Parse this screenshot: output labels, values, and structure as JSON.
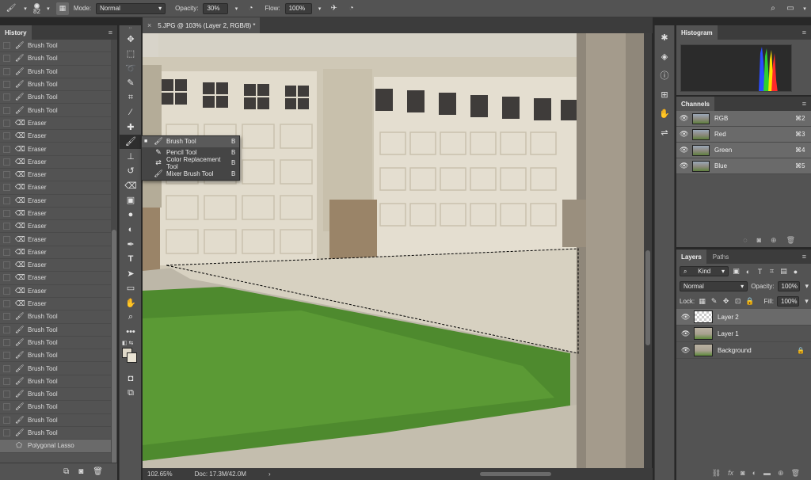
{
  "options_bar": {
    "brush_size": "82",
    "mode_label": "Mode:",
    "mode_value": "Normal",
    "opacity_label": "Opacity:",
    "opacity_value": "30%",
    "flow_label": "Flow:",
    "flow_value": "100%"
  },
  "history": {
    "title": "History",
    "items": [
      {
        "label": "Brush Tool",
        "icon": "brush-icon"
      },
      {
        "label": "Brush Tool",
        "icon": "brush-icon"
      },
      {
        "label": "Brush Tool",
        "icon": "brush-icon"
      },
      {
        "label": "Brush Tool",
        "icon": "brush-icon"
      },
      {
        "label": "Brush Tool",
        "icon": "brush-icon"
      },
      {
        "label": "Brush Tool",
        "icon": "brush-icon"
      },
      {
        "label": "Eraser",
        "icon": "eraser-icon"
      },
      {
        "label": "Eraser",
        "icon": "eraser-icon"
      },
      {
        "label": "Eraser",
        "icon": "eraser-icon"
      },
      {
        "label": "Eraser",
        "icon": "eraser-icon"
      },
      {
        "label": "Eraser",
        "icon": "eraser-icon"
      },
      {
        "label": "Eraser",
        "icon": "eraser-icon"
      },
      {
        "label": "Eraser",
        "icon": "eraser-icon"
      },
      {
        "label": "Eraser",
        "icon": "eraser-icon"
      },
      {
        "label": "Eraser",
        "icon": "eraser-icon"
      },
      {
        "label": "Eraser",
        "icon": "eraser-icon"
      },
      {
        "label": "Eraser",
        "icon": "eraser-icon"
      },
      {
        "label": "Eraser",
        "icon": "eraser-icon"
      },
      {
        "label": "Eraser",
        "icon": "eraser-icon"
      },
      {
        "label": "Eraser",
        "icon": "eraser-icon"
      },
      {
        "label": "Eraser",
        "icon": "eraser-icon"
      },
      {
        "label": "Brush Tool",
        "icon": "brush-icon"
      },
      {
        "label": "Brush Tool",
        "icon": "brush-icon"
      },
      {
        "label": "Brush Tool",
        "icon": "brush-icon"
      },
      {
        "label": "Brush Tool",
        "icon": "brush-icon"
      },
      {
        "label": "Brush Tool",
        "icon": "brush-icon"
      },
      {
        "label": "Brush Tool",
        "icon": "brush-icon"
      },
      {
        "label": "Brush Tool",
        "icon": "brush-icon"
      },
      {
        "label": "Brush Tool",
        "icon": "brush-icon"
      },
      {
        "label": "Brush Tool",
        "icon": "brush-icon"
      },
      {
        "label": "Brush Tool",
        "icon": "brush-icon"
      },
      {
        "label": "Polygonal Lasso",
        "icon": "polygonal-lasso-icon",
        "selected": true
      }
    ]
  },
  "document": {
    "tab_title": "5.JPG @ 103% (Layer 2, RGB/8) *",
    "zoom": "102.65%",
    "doc_size": "Doc: 17.3M/42.0M"
  },
  "tool_flyout": {
    "items": [
      {
        "label": "Brush Tool",
        "key": "B",
        "active": true
      },
      {
        "label": "Pencil Tool",
        "key": "B"
      },
      {
        "label": "Color Replacement Tool",
        "key": "B"
      },
      {
        "label": "Mixer Brush Tool",
        "key": "B"
      }
    ]
  },
  "histogram": {
    "title": "Histogram"
  },
  "channels": {
    "title": "Channels",
    "items": [
      {
        "name": "RGB",
        "shortcut": "⌘2"
      },
      {
        "name": "Red",
        "shortcut": "⌘3"
      },
      {
        "name": "Green",
        "shortcut": "⌘4"
      },
      {
        "name": "Blue",
        "shortcut": "⌘5"
      }
    ]
  },
  "layers": {
    "tab_layers": "Layers",
    "tab_paths": "Paths",
    "filter_kind": "Kind",
    "blend_mode": "Normal",
    "opacity_label": "Opacity:",
    "opacity_value": "100%",
    "lock_label": "Lock:",
    "fill_label": "Fill:",
    "fill_value": "100%",
    "items": [
      {
        "name": "Layer 2",
        "selected": true
      },
      {
        "name": "Layer 1"
      },
      {
        "name": "Background",
        "locked": true
      }
    ]
  },
  "colors": {
    "panel_bg": "#535353",
    "panel_header": "#3c3c3c",
    "selected_row": "#6a6a6a",
    "foreground_swatch": "#e0d9c9",
    "background_swatch": "#e9e3d3"
  }
}
